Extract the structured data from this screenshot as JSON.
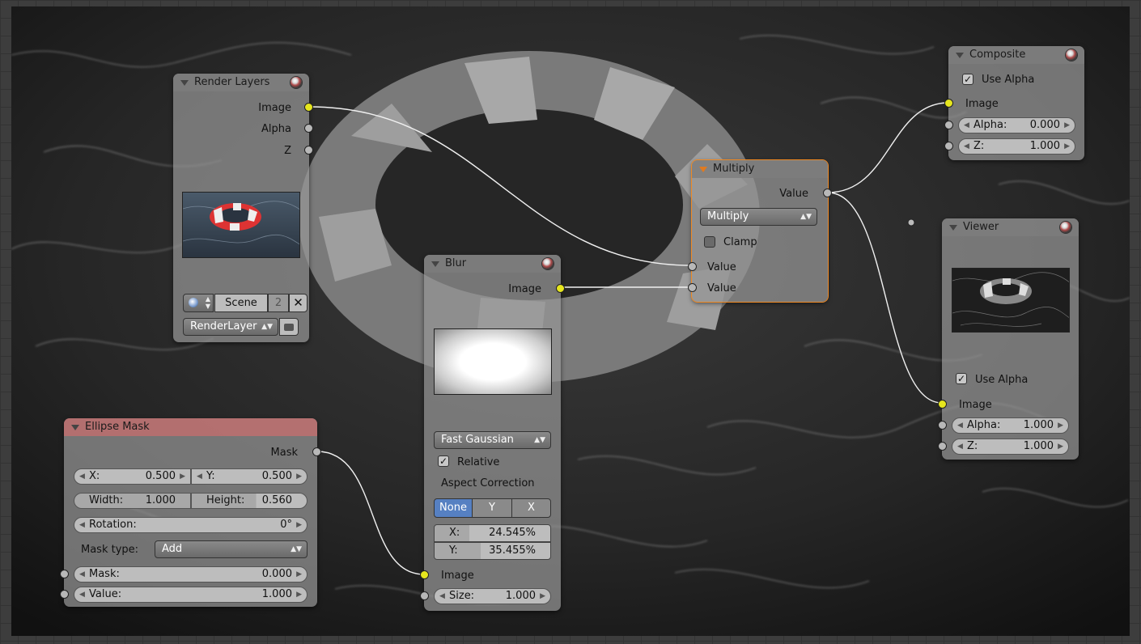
{
  "colors": {
    "socket_image": "#e6e61e",
    "socket_value": "#b8b8b8",
    "active_outline": "#f08a24",
    "none_selected": "#5680c2"
  },
  "render_layers": {
    "title": "Render Layers",
    "outputs": [
      "Image",
      "Alpha",
      "Z"
    ],
    "scene_label": "Scene",
    "scene_users": "2",
    "layer": "RenderLayer"
  },
  "blur": {
    "title": "Blur",
    "output": "Image",
    "filter_type": "Fast Gaussian",
    "relative_label": "Relative",
    "relative_checked": true,
    "aspect_label": "Aspect Correction",
    "aspect_options": [
      "None",
      "Y",
      "X"
    ],
    "aspect_selected": "None",
    "x_label": "X:",
    "x_value": "24.545%",
    "y_label": "Y:",
    "y_value": "35.455%",
    "input_image": "Image",
    "size_label": "Size:",
    "size_value": "1.000"
  },
  "multiply": {
    "title": "Multiply",
    "output": "Value",
    "operation": "Multiply",
    "clamp_label": "Clamp",
    "clamp_checked": false,
    "inputs": [
      "Value",
      "Value"
    ]
  },
  "composite": {
    "title": "Composite",
    "use_alpha_label": "Use Alpha",
    "input_image": "Image",
    "alpha_label": "Alpha:",
    "alpha_value": "0.000",
    "z_label": "Z:",
    "z_value": "1.000"
  },
  "viewer": {
    "title": "Viewer",
    "use_alpha_label": "Use Alpha",
    "input_image": "Image",
    "alpha_label": "Alpha:",
    "alpha_value": "1.000",
    "z_label": "Z:",
    "z_value": "1.000"
  },
  "ellipse_mask": {
    "title": "Ellipse Mask",
    "output": "Mask",
    "x_label": "X:",
    "x_value": "0.500",
    "y_label": "Y:",
    "y_value": "0.500",
    "width_label": "Width:",
    "width_value": "1.000",
    "height_label": "Height:",
    "height_value": "0.560",
    "rotation_label": "Rotation:",
    "rotation_value": "0°",
    "mask_type_label": "Mask type:",
    "mask_type_value": "Add",
    "mask_label": "Mask:",
    "mask_value": "0.000",
    "value_label": "Value:",
    "value_value": "1.000"
  }
}
